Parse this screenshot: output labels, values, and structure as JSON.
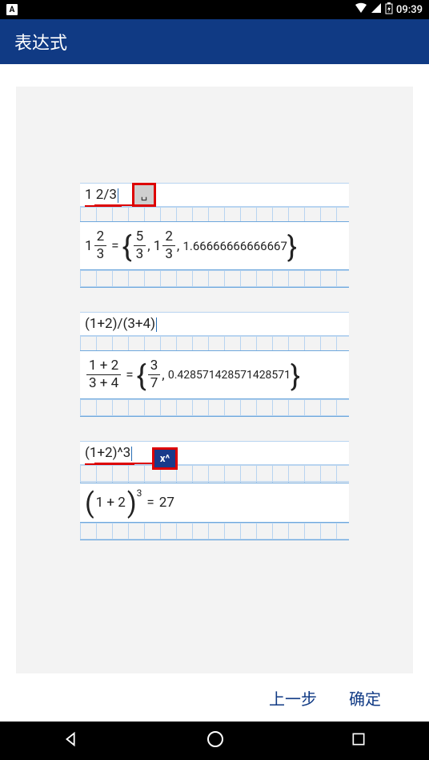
{
  "status": {
    "time": "09:39",
    "keyboard_indicator": "A"
  },
  "app_bar": {
    "title": "表达式"
  },
  "examples": [
    {
      "input_text": "1 2/3",
      "callout_label": "␣",
      "result": {
        "mixed_whole": "1",
        "mixed_num": "2",
        "mixed_den": "3",
        "frac1_num": "5",
        "frac1_den": "3",
        "mixed2_whole": "1",
        "mixed2_num": "2",
        "mixed2_den": "3",
        "decimal": "1.66666666666667"
      }
    },
    {
      "input_text": "(1+2)/(3+4)",
      "result": {
        "top": "1 + 2",
        "bot": "3 + 4",
        "frac_num": "3",
        "frac_den": "7",
        "decimal": "0.428571428571428571"
      }
    },
    {
      "input_text": "(1+2)^3",
      "callout_label": "x^",
      "result": {
        "base": "1 + 2",
        "exp": "3",
        "value": "27"
      }
    }
  ],
  "footer": {
    "prev": "上一步",
    "ok": "确定"
  }
}
